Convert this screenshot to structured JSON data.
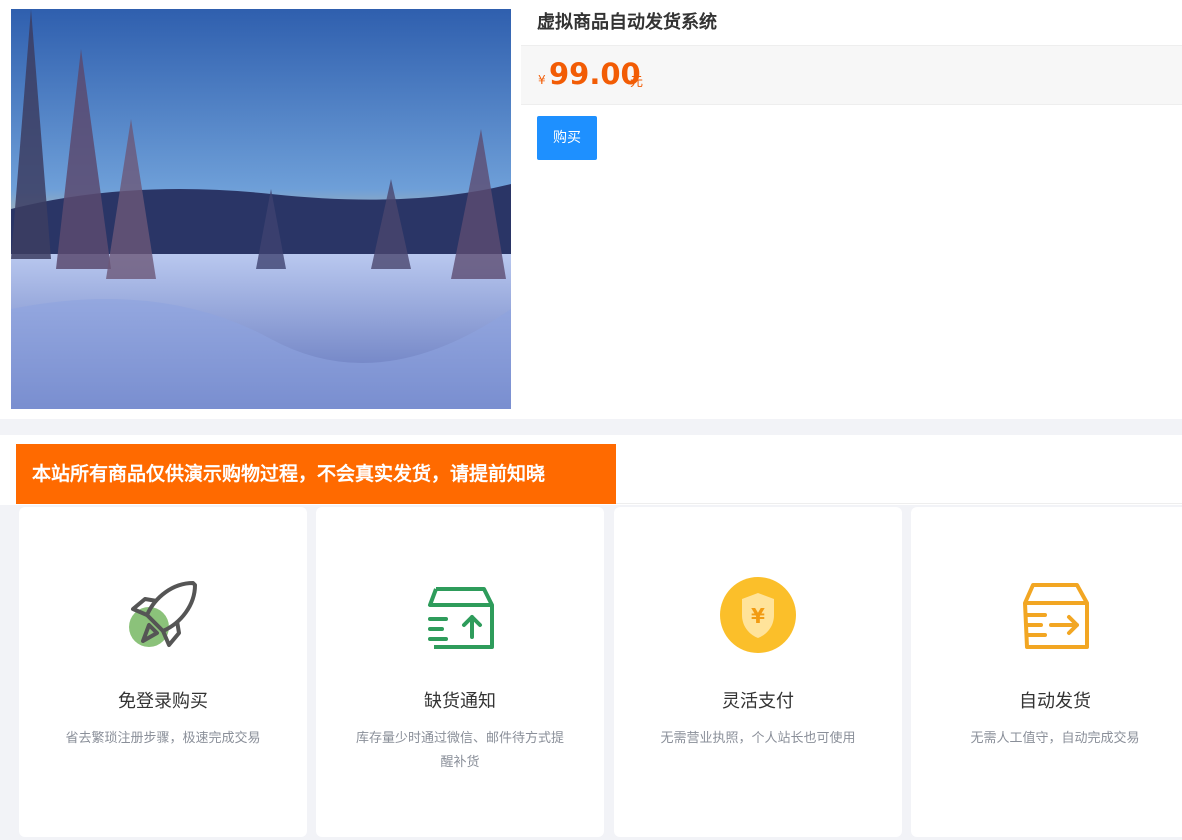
{
  "product": {
    "title": "虚拟商品自动发货系统",
    "price_currency": "¥",
    "price_value": "99.00",
    "price_unit": "元",
    "buy_label": "购买",
    "image_name": "snowy-forest-image"
  },
  "notice": {
    "text": "本站所有商品仅供演示购物过程，不会真实发货，请提前知晓"
  },
  "features": [
    {
      "icon": "rocket-icon",
      "title": "免登录购买",
      "desc": "省去繁琐注册步骤，极速完成交易"
    },
    {
      "icon": "box-upload-icon",
      "title": "缺货通知",
      "desc": "库存量少时通过微信、邮件待方式提醒补货"
    },
    {
      "icon": "yuan-shield-icon",
      "title": "灵活支付",
      "desc": "无需营业执照，个人站长也可使用"
    },
    {
      "icon": "box-delivery-icon",
      "title": "自动发货",
      "desc": "无需人工值守，自动完成交易"
    }
  ],
  "colors": {
    "accent_orange": "#ff6a00",
    "price_orange": "#f25c05",
    "button_blue": "#1e90ff",
    "green": "#2e9c5b",
    "yellow": "#fbbf2a",
    "amber": "#f2a623"
  }
}
